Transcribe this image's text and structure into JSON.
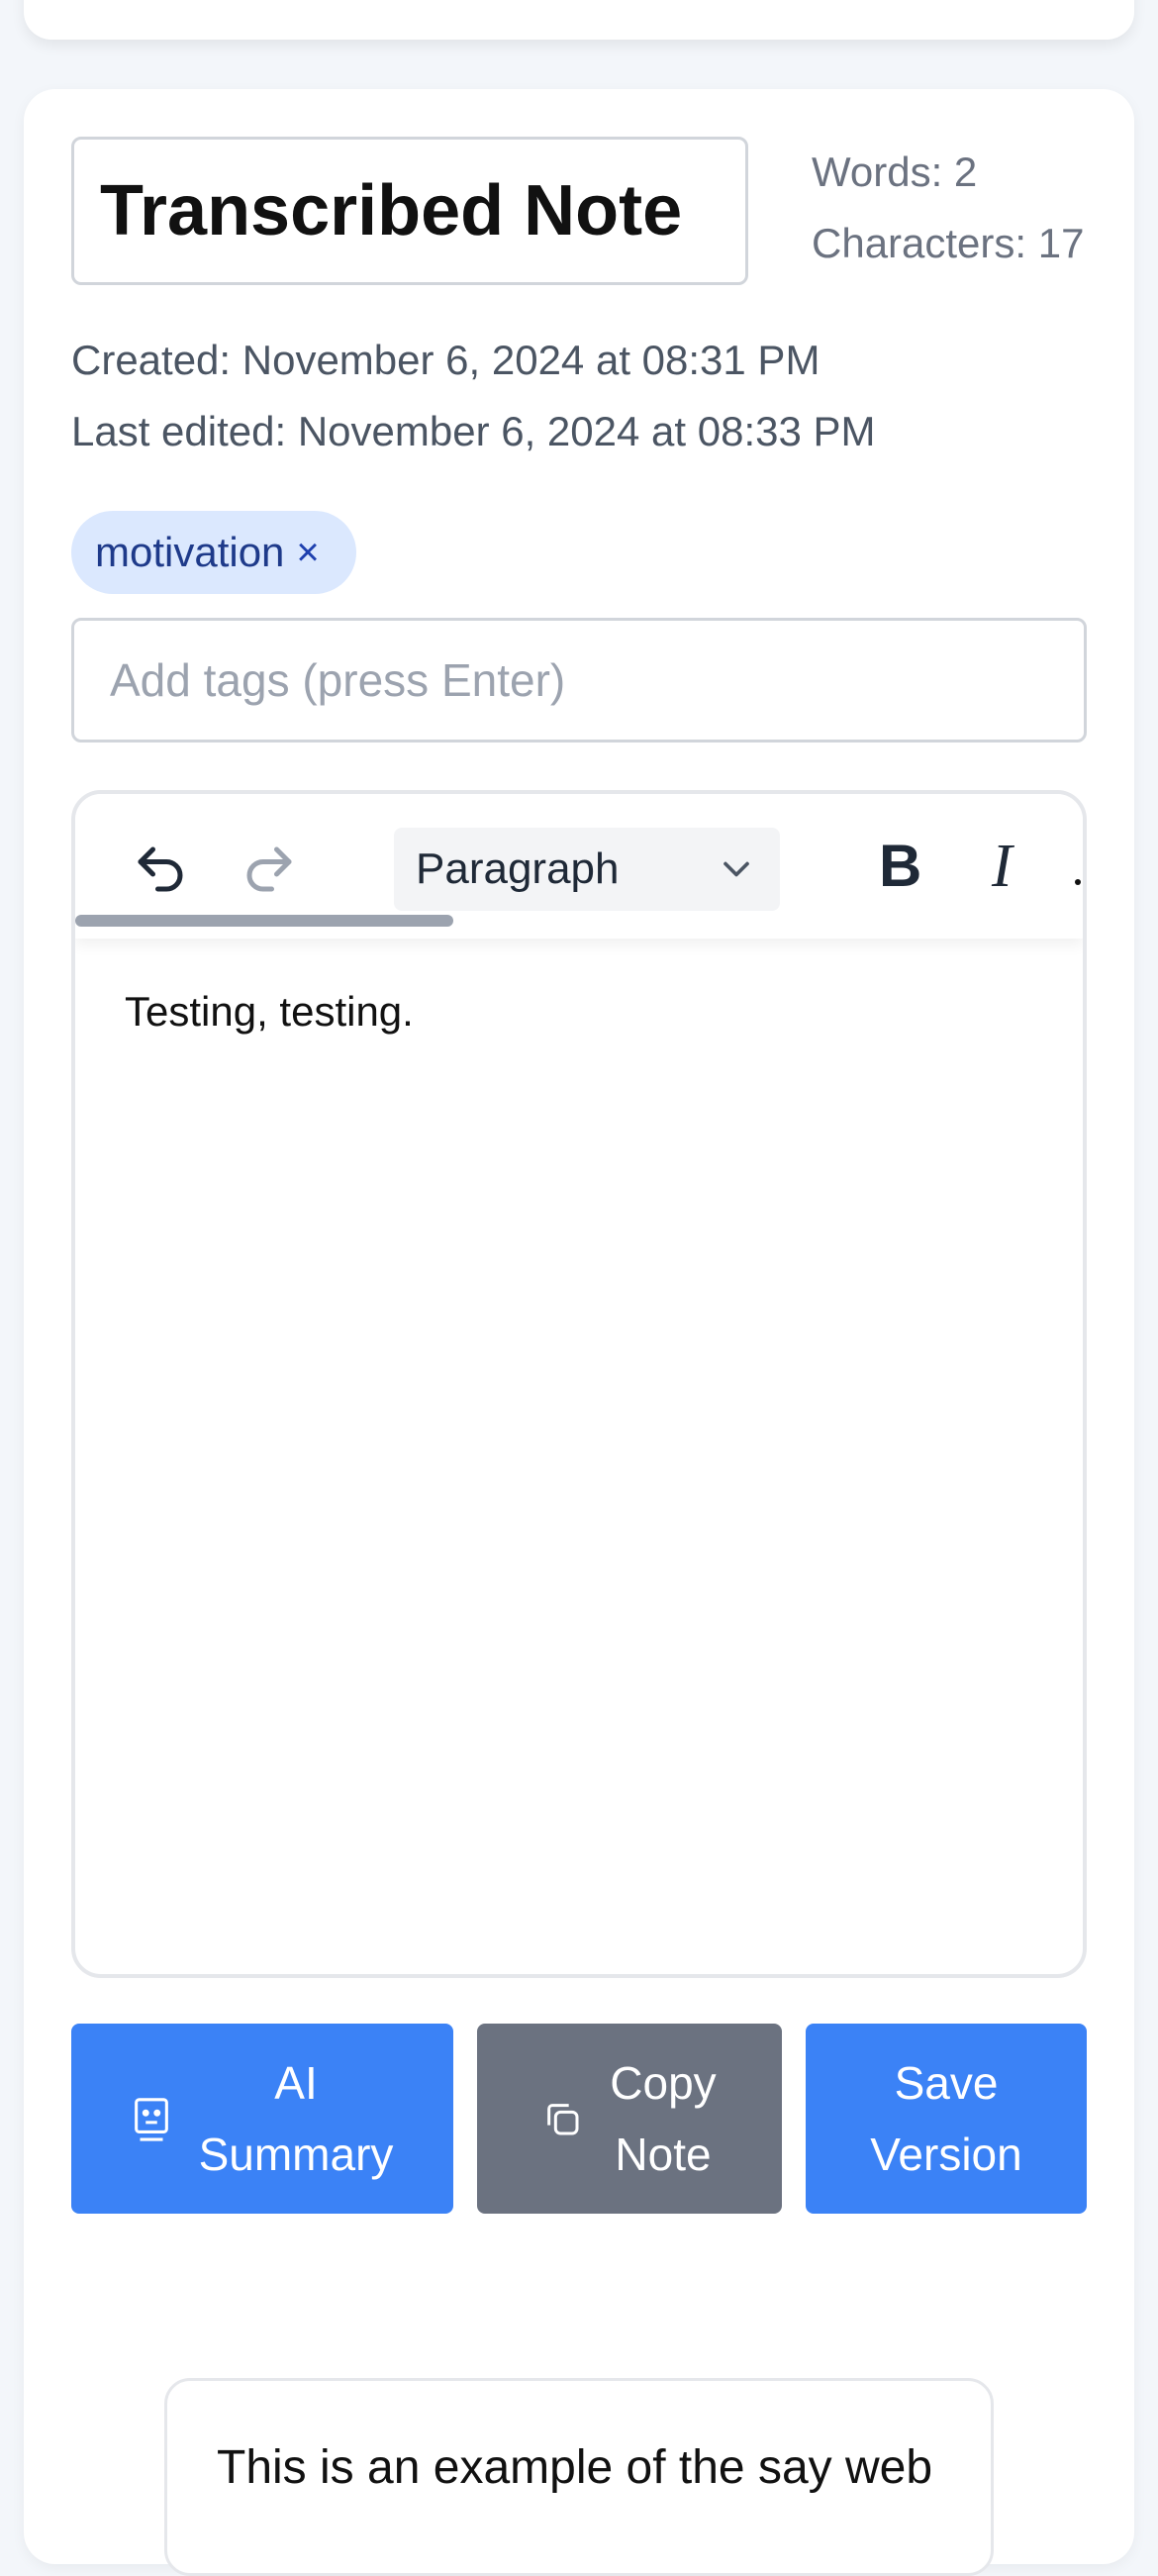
{
  "note": {
    "title": "Transcribed Note",
    "words": "Words: 2",
    "characters": "Characters: 17",
    "created": "Created: November 6, 2024 at 08:31 PM",
    "last_edited": "Last edited: November 6, 2024 at 08:33 PM"
  },
  "tags": {
    "items": [
      {
        "label": "motivation",
        "remove": "×"
      }
    ],
    "input_placeholder": "Add tags (press Enter)"
  },
  "toolbar": {
    "block_type": "Paragraph",
    "bold": "B",
    "italic": "I",
    "icons": [
      "undo-icon",
      "redo-icon",
      "chevron-down-icon"
    ]
  },
  "editor": {
    "content": "Testing, testing."
  },
  "actions": {
    "ai_summary": {
      "line1": "AI",
      "line2": "Summary",
      "icon": "robot-icon"
    },
    "copy_note": {
      "line1": "Copy",
      "line2": "Note",
      "icon": "copy-icon"
    },
    "save_version": {
      "line1": "Save",
      "line2": "Version"
    }
  },
  "preview": {
    "text": "This is an example of the say web"
  },
  "colors": {
    "primary": "#3b82f6",
    "secondary": "#6b7280",
    "tag_bg": "#dbe8fe"
  }
}
